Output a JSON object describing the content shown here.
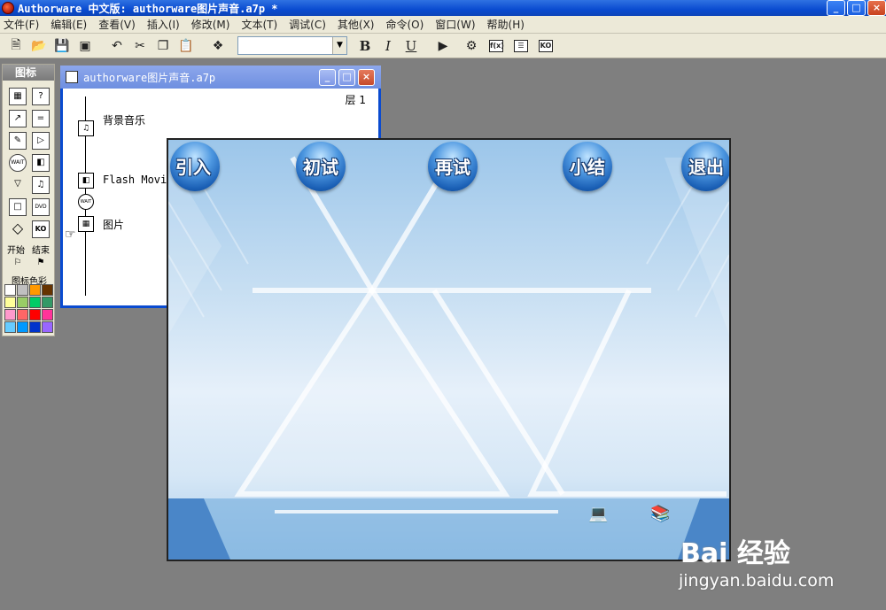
{
  "window": {
    "title": "Authorware 中文版: authorware图片声音.a7p *",
    "buttons": [
      "_",
      "□",
      "×"
    ]
  },
  "menu": [
    "文件(F)",
    "编辑(E)",
    "查看(V)",
    "插入(I)",
    "修改(M)",
    "文本(T)",
    "调试(C)",
    "其他(X)",
    "命令(O)",
    "窗口(W)",
    "帮助(H)"
  ],
  "toolbar": {
    "bold": "B",
    "italic": "I",
    "underline": "U",
    "font_box": "",
    "fx_label": "f(x)",
    "ko_label": "KO"
  },
  "palette": {
    "title": "图标",
    "start_label": "开始",
    "end_label": "结束",
    "color_label": "图标色彩",
    "colors": [
      "#ffffff",
      "#c0c0c0",
      "#ff9900",
      "#663300",
      "#ffff99",
      "#99cc66",
      "#00cc66",
      "#339966",
      "#ff99cc",
      "#ff6666",
      "#ff0000",
      "#ff3399",
      "#66ccff",
      "#0099ff",
      "#0033cc",
      "#9966ff"
    ],
    "icons": [
      "display",
      "interaction",
      "calculation",
      "map",
      "erase",
      "navigate",
      "wait",
      "movie",
      "motion",
      "framework",
      "decision",
      "sound",
      "DVD",
      "KO"
    ]
  },
  "flow_window": {
    "title": "authorware图片声音.a7p",
    "level": "层 1",
    "nodes": [
      {
        "label": "背景音乐",
        "icon": "sound-icon"
      },
      {
        "label": "Flash Movie",
        "icon": "flash-icon"
      },
      {
        "label": "",
        "icon": "wait-icon"
      },
      {
        "label": "图片",
        "icon": "display-icon"
      }
    ]
  },
  "stage": {
    "buttons": [
      "引入",
      "初试",
      "再试",
      "小结",
      "退出"
    ]
  },
  "watermark": {
    "logo": "Bai 经验",
    "url": "jingyan.baidu.com"
  }
}
